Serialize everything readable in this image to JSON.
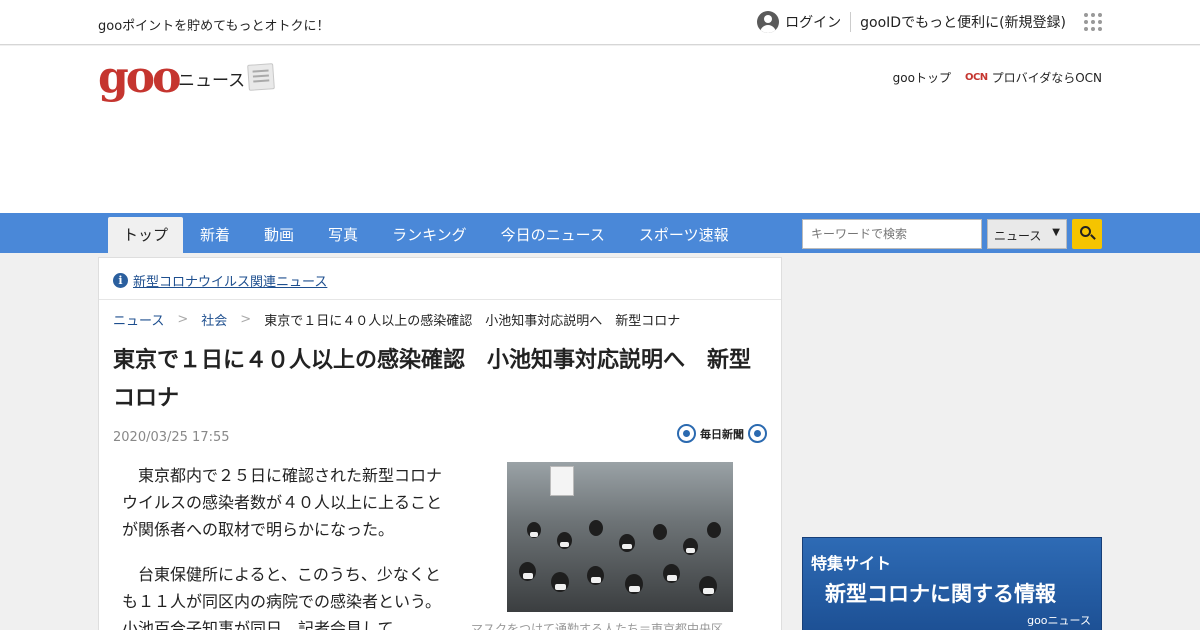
{
  "topbar": {
    "promo": "gooポイントを貯めてもっとオトクに！",
    "login": "ログイン",
    "register": "gooIDでもっと便利に(新規登録)"
  },
  "header": {
    "logo": "goo",
    "logo_sub": "ニュース",
    "goo_top": "gooトップ",
    "ocn_badge": "OCN",
    "ocn_link": "プロバイダならOCN"
  },
  "nav": {
    "tabs": [
      "トップ",
      "新着",
      "動画",
      "写真",
      "ランキング",
      "今日のニュース",
      "スポーツ速報"
    ],
    "search_placeholder": "キーワードで検索",
    "search_scope": "ニュース"
  },
  "article": {
    "related_link": "新型コロナウイルス関連ニュース",
    "breadcrumb": [
      "ニュース",
      "社会",
      "東京で１日に４０人以上の感染確認　小池知事対応説明へ　新型コロナ"
    ],
    "headline": "東京で１日に４０人以上の感染確認　小池知事対応説明へ　新型コロナ",
    "date": "2020/03/25 17:55",
    "source": "毎日新聞",
    "paragraphs": [
      "東京都内で２５日に確認された新型コロナウイルスの感染者数が４０人以上に上ることが関係者への取材で明らかになった。",
      "台東保健所によると、このうち、少なくとも１１人が同区内の病院での感染者という。小池百合子知事が同日、記者会見して"
    ],
    "photo_caption": "マスクをつけて通勤する人たち＝東京都中央区"
  },
  "sidebar": {
    "banner_sub": "特集サイト",
    "banner_main": "新型コロナに関する情報",
    "banner_brand": "gooニュース"
  },
  "colors": {
    "nav_bg": "#4a88d8",
    "logo_red": "#c5352f",
    "link_blue": "#1e4f8f",
    "search_button": "#f5c400"
  }
}
